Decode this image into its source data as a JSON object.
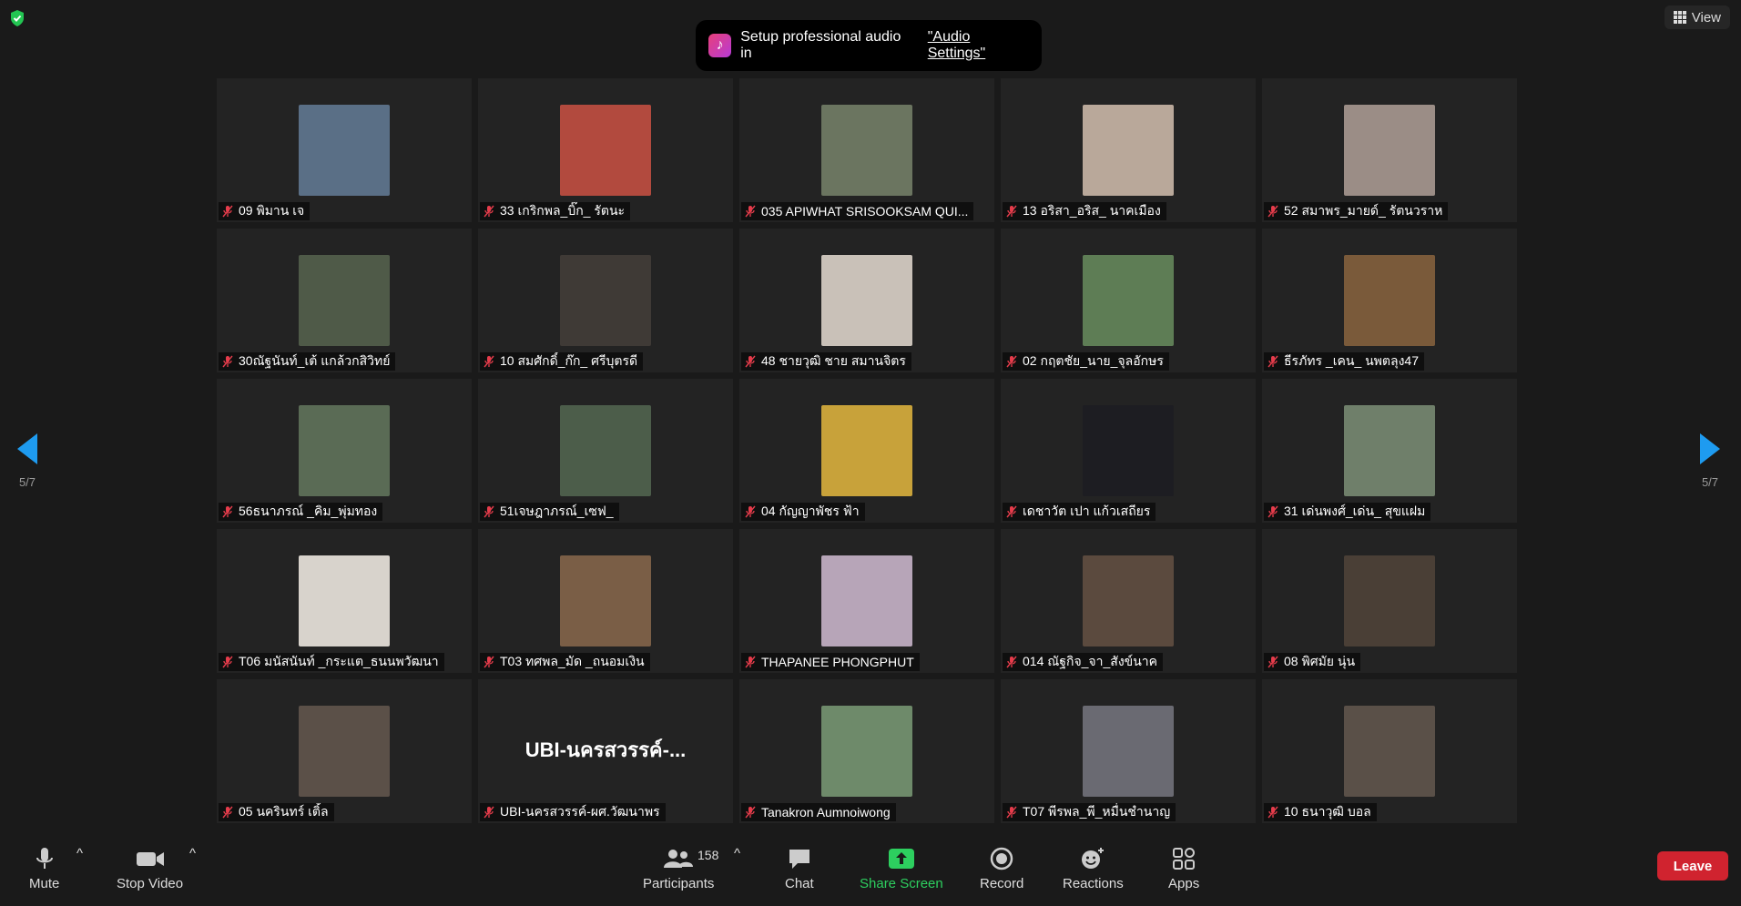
{
  "banner": {
    "text": "Setup professional audio in",
    "link": "\"Audio Settings\""
  },
  "view_button": {
    "label": "View"
  },
  "pagination": {
    "left": "5/7",
    "right": "5/7"
  },
  "participants": [
    {
      "name": "09 พิมาน เจ",
      "photo": "#5a6f86"
    },
    {
      "name": "33 เกริกพล_บิ๊ก_ รัตนะ",
      "photo": "#b24a3e"
    },
    {
      "name": "035 APIWHAT SRISOOKSAM QUI...",
      "photo": "#6b7560"
    },
    {
      "name": "13 อริสา_อริส_ นาคเมือง",
      "photo": "#b9a89a"
    },
    {
      "name": "52 สมาพร_มายด์_ รัตนวราห",
      "photo": "#9b8d86"
    },
    {
      "name": "30ณัฐนันท์_เต้ แกล้วกสิวิทย์",
      "photo": "#4f5a48"
    },
    {
      "name": "10 สมศักดิ์_ก๊ก_ ศรีบุตรดี",
      "photo": "#3f3a36"
    },
    {
      "name": "48 ชายวุฒิ ชาย สมานจิตร",
      "photo": "#c9c1b8"
    },
    {
      "name": "02 กฤตชัย_นาย_จุลอักษร",
      "photo": "#5e7d55"
    },
    {
      "name": "ธีรภัทร _เคน_ นพตลุง47",
      "photo": "#7a5a3a"
    },
    {
      "name": "56ธนาภรณ์ _คิม_พุ่มทอง",
      "photo": "#5a6b55"
    },
    {
      "name": "51เจษฎาภรณ์_เซฟ_",
      "photo": "#4c5d4a"
    },
    {
      "name": "04 กัญญาพัชร ฟ้า",
      "photo": "#c8a23a"
    },
    {
      "name": "เดชาวัต เปา แก้วเสถียร",
      "photo": "#1d1d22"
    },
    {
      "name": "31 เด่นพงศ์_เด่น_ สุขแฝม",
      "photo": "#6f7f6a"
    },
    {
      "name": "T06 มนัสนันท์ _กระแต_ธนนพวัฒนา",
      "photo": "#d8d3cc"
    },
    {
      "name": "T03 ทศพล_มัด _ถนอมเงิน",
      "photo": "#7a5e46"
    },
    {
      "name": "THAPANEE PHONGPHUT",
      "photo": "#b7a5b8"
    },
    {
      "name": "014 ณัฐกิจ_จา_สังข์นาค",
      "photo": "#5b4a3e"
    },
    {
      "name": "08 พิศมัย นุ่น",
      "photo": "#4a3f36"
    },
    {
      "name": "05 นครินทร์ เติ้ล",
      "photo": "#5b5048"
    },
    {
      "name": "UBI-นครสวรรค์-ผศ.วัฒนาพร",
      "photo": "",
      "display_name": "UBI-นครสวรรค์-..."
    },
    {
      "name": "Tanakron Aumnoiwong",
      "photo": "#6e8a6a"
    },
    {
      "name": "T07 พีรพล_พี_หมื่นชำนาญ",
      "photo": "#6a6a72"
    },
    {
      "name": "10 ธนาวุฒิ บอล",
      "photo": "#5a5048"
    }
  ],
  "toolbar": {
    "mute": "Mute",
    "stop_video": "Stop Video",
    "participants": "Participants",
    "participant_count": "158",
    "chat": "Chat",
    "share_screen": "Share Screen",
    "record": "Record",
    "reactions": "Reactions",
    "apps": "Apps",
    "leave": "Leave"
  },
  "icons": {
    "security": "shield-check-icon",
    "mic": "microphone-icon",
    "video": "video-camera-icon",
    "participants": "people-icon",
    "chat": "chat-bubble-icon",
    "share": "share-arrow-icon",
    "record": "record-icon",
    "reactions": "smiley-icon",
    "apps": "apps-icon"
  },
  "colors": {
    "accent": "#1e9bf0",
    "share": "#2dcf5f",
    "leave": "#d0232f",
    "mic_off": "#e53c4b"
  }
}
